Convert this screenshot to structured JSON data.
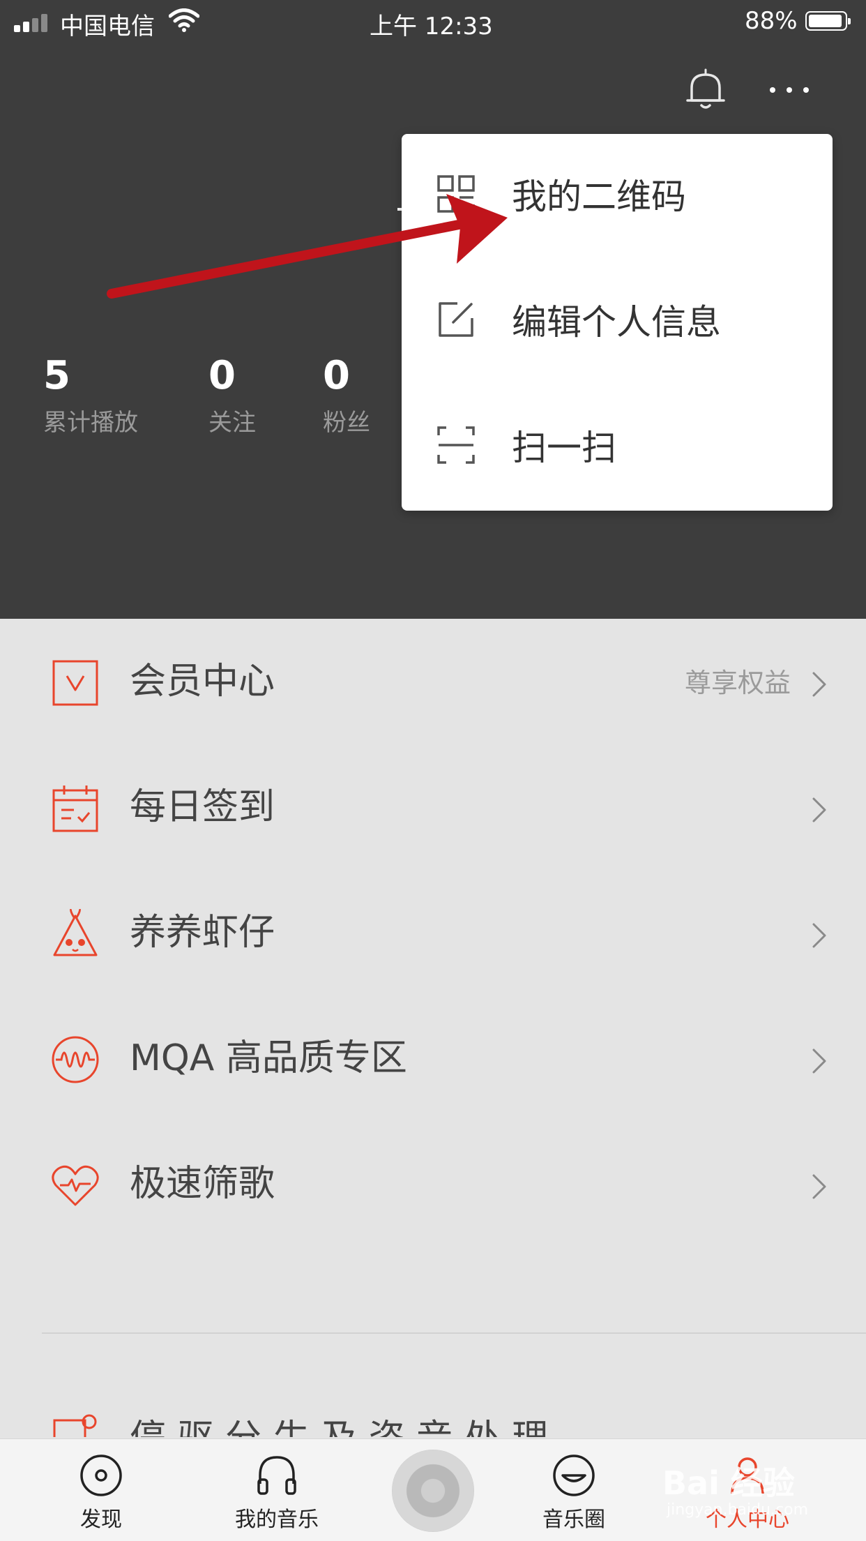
{
  "status_bar": {
    "carrier": "中国电信",
    "time": "上午 12:33",
    "battery": "88%"
  },
  "stats": [
    {
      "value": "5",
      "label": "累计播放"
    },
    {
      "value": "0",
      "label": "关注"
    },
    {
      "value": "0",
      "label": "粉丝"
    }
  ],
  "popup_menu": {
    "items": [
      {
        "label": "我的二维码",
        "icon": "qr-code-icon"
      },
      {
        "label": "编辑个人信息",
        "icon": "edit-icon"
      },
      {
        "label": "扫一扫",
        "icon": "scan-icon"
      }
    ]
  },
  "menu": {
    "items": [
      {
        "label": "会员中心",
        "extra": "尊享权益",
        "icon": "vip-icon"
      },
      {
        "label": "每日签到",
        "extra": "",
        "icon": "calendar-check-icon"
      },
      {
        "label": "养养虾仔",
        "extra": "",
        "icon": "shrimp-pet-icon"
      },
      {
        "label": "MQA 高品质专区",
        "extra": "",
        "icon": "waveform-icon"
      },
      {
        "label": "极速筛歌",
        "extra": "",
        "icon": "heart-pulse-icon"
      }
    ],
    "partial_row_label": "停 驱 分 生 及 咨 音 处 理"
  },
  "tabbar": {
    "tabs": [
      {
        "label": "发现",
        "icon": "disc-icon"
      },
      {
        "label": "我的音乐",
        "icon": "headphones-icon"
      },
      {
        "label": "音乐圈",
        "icon": "smile-icon"
      },
      {
        "label": "个人中心",
        "icon": "user-icon"
      }
    ]
  },
  "watermark": {
    "brand": "Bai 经验",
    "url": "jingyan.baidu.com"
  },
  "colors": {
    "accent": "#e8452c",
    "header_bg": "#3d3d3d",
    "page_bg": "#e4e4e4",
    "annotation_arrow": "#c0141b"
  }
}
